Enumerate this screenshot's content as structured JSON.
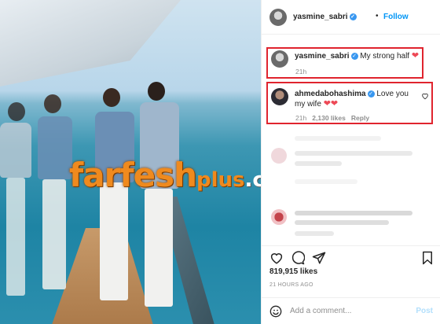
{
  "watermark": {
    "part1": "farfesh",
    "part2": "plus",
    "part3": ".com"
  },
  "post": {
    "username": "yasmine_sabri",
    "follow_dot": "•",
    "follow_label": "Follow",
    "caption_user": "yasmine_sabri",
    "caption_text": "My strong half",
    "caption_emoji": "❤",
    "caption_age": "21h"
  },
  "comment": {
    "user": "ahmedabohashima",
    "text_line1": "Love you",
    "text_line2": "my wife",
    "emoji": "❤❤",
    "age": "21h",
    "likes": "2,130 likes",
    "reply": "Reply"
  },
  "actions": {
    "like_icon": "heart-outline-icon",
    "comment_icon": "comment-bubble-icon",
    "share_icon": "paper-plane-icon",
    "save_icon": "bookmark-icon"
  },
  "stats": {
    "likes": "819,915 likes",
    "posted": "21 HOURS AGO"
  },
  "composer": {
    "placeholder": "Add a comment...",
    "post_label": "Post",
    "emoji_icon": "smiley-icon"
  },
  "colors": {
    "accent": "#0095f6",
    "highlight_box": "#e0242e",
    "heart": "#ed4956",
    "verified": "#3897f0"
  }
}
